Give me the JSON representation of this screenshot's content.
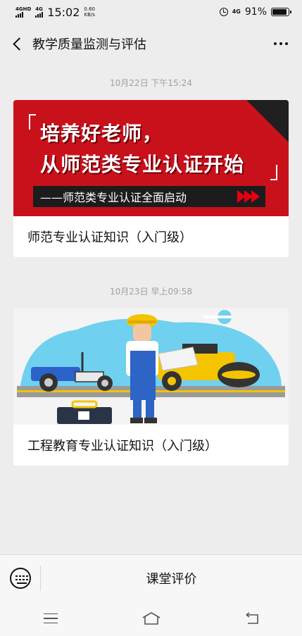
{
  "status_bar": {
    "signal1_label": "4GHD",
    "signal2_label": "4G",
    "time": "15:02",
    "speed_value": "0.60",
    "speed_unit": "KB/s",
    "network": "4G",
    "battery": "91%",
    "battery_level": 0.91
  },
  "nav": {
    "title": "教学质量监测与评估",
    "back_icon": "chevron-left-icon",
    "more_icon": "more-dots-icon"
  },
  "messages": [
    {
      "timestamp": "10月22日 下午15:24",
      "banner": {
        "line1": "培养好老师，",
        "line2": "从师范类专业认证开始",
        "subline": "——师范类专业认证全面启动"
      },
      "caption": "师范专业认证知识（入门级）"
    },
    {
      "timestamp": "10月23日 早上09:58",
      "caption": "工程教育专业认证知识（入门级）"
    }
  ],
  "bottom_menu": {
    "keyboard_icon": "keyboard-icon",
    "item_label": "课堂评价"
  },
  "system_nav": {
    "menu_icon": "menu-icon",
    "home_icon": "home-icon",
    "back_icon": "back-arrow-icon"
  },
  "colors": {
    "background": "#ededed",
    "banner_red": "#c9111c",
    "timestamp_gray": "#a0a0a0"
  }
}
